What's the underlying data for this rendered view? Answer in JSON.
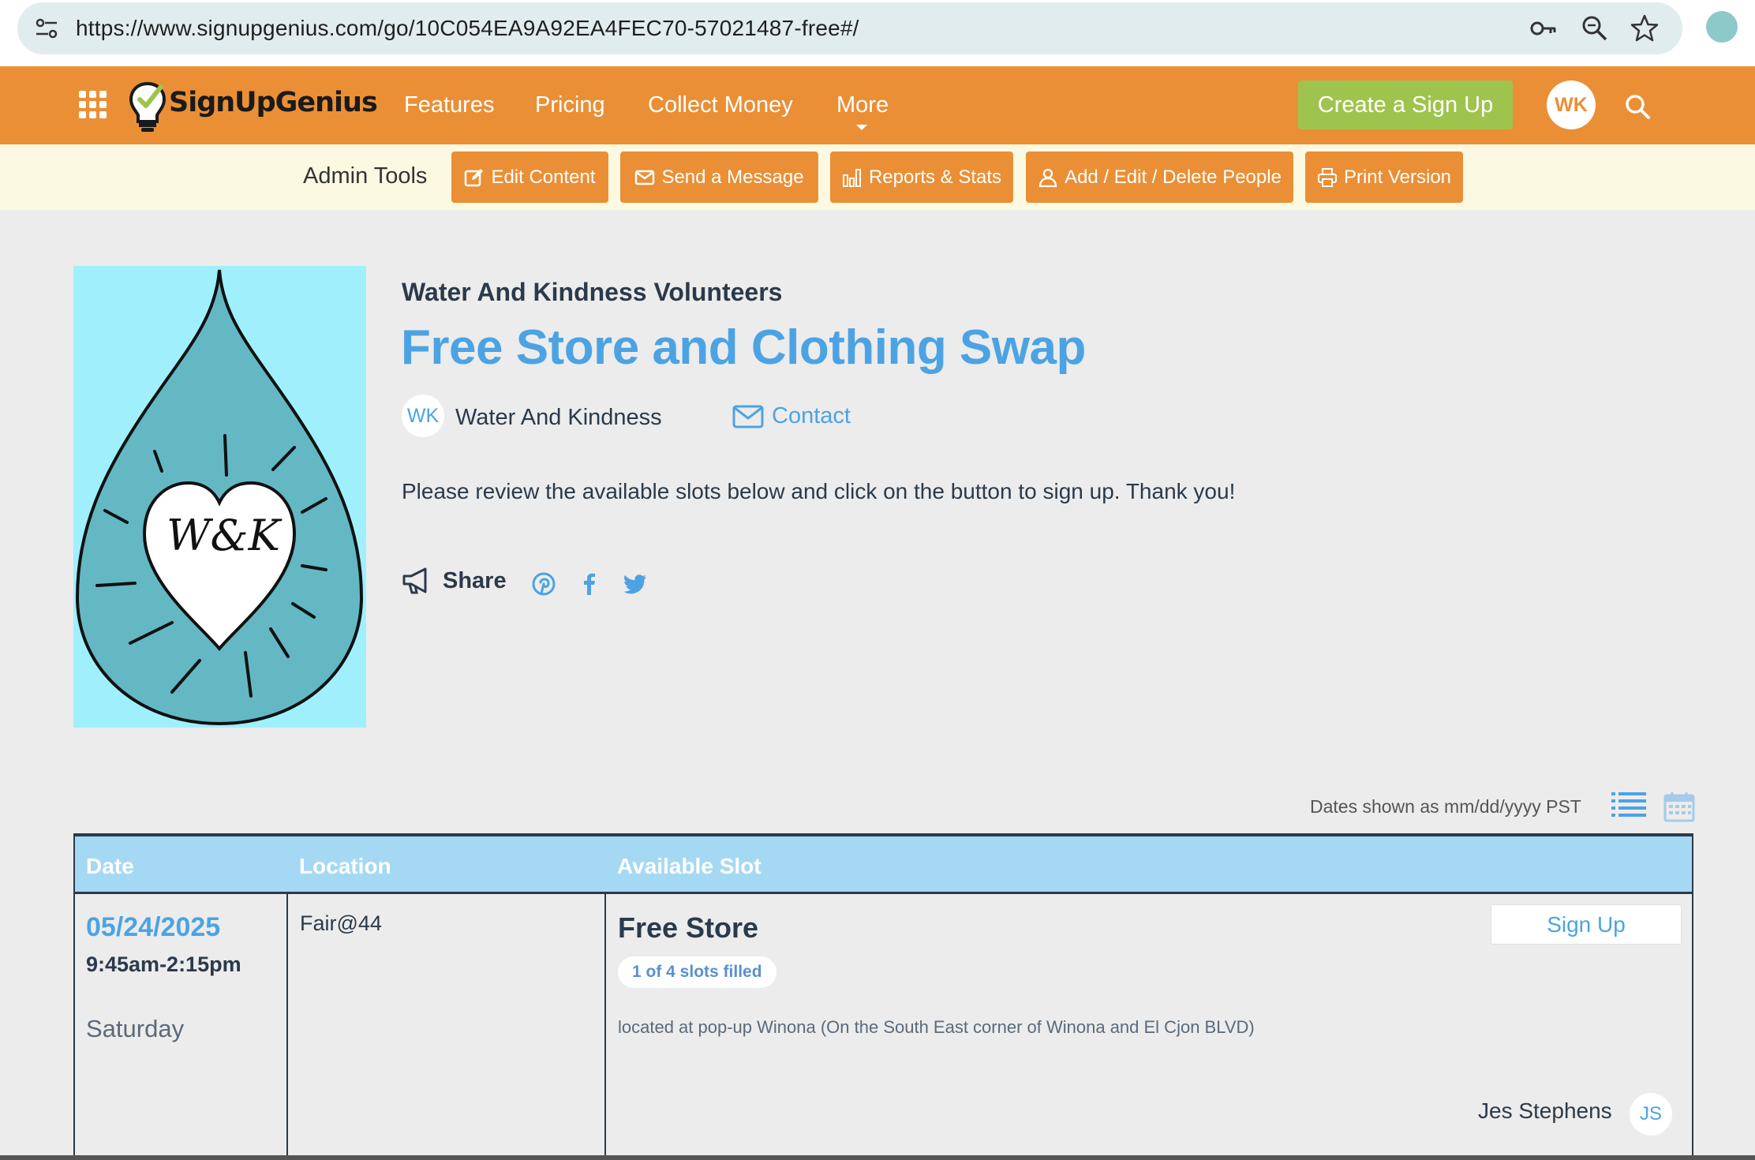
{
  "browser": {
    "url": "https://www.signupgenius.com/go/10C054EA9A92EA4FEC70-57021487-free#/",
    "icons": [
      "site-settings-icon",
      "key-icon",
      "zoom-icon",
      "star-icon",
      "extension-icon"
    ]
  },
  "nav": {
    "logo_text": "SignUpGenius",
    "links": [
      "Features",
      "Pricing",
      "Collect Money",
      "More"
    ],
    "create_button": "Create a Sign Up",
    "user_initials": "WK",
    "colors": {
      "bar": "#ea8f35",
      "create": "#9fc44e"
    }
  },
  "admin": {
    "label": "Admin Tools",
    "buttons": [
      "Edit Content",
      "Send a Message",
      "Reports & Stats",
      "Add / Edit / Delete People",
      "Print Version"
    ]
  },
  "signup": {
    "group": "Water And Kindness Volunteers",
    "title": "Free Store and Clothing Swap",
    "org_initials": "WK",
    "org_name": "Water And Kindness",
    "contact": "Contact",
    "intro": "Please review the available slots below and click on the button to sign up. Thank you!",
    "share_label": "Share",
    "logo_text": "W&K"
  },
  "table": {
    "dates_note": "Dates shown as mm/dd/yyyy PST",
    "headers": [
      "Date",
      "Location",
      "Available Slot"
    ],
    "rows": [
      {
        "date": "05/24/2025",
        "time": "9:45am-2:15pm",
        "weekday": "Saturday",
        "location": "Fair@44",
        "slot": "Free Store",
        "filled": "1 of 4 slots filled",
        "description": "located at pop-up Winona (On the South East corner of Winona and El Cjon BLVD)",
        "button": "Sign Up",
        "person": "Jes Stephens",
        "person_initials": "JS"
      }
    ]
  }
}
